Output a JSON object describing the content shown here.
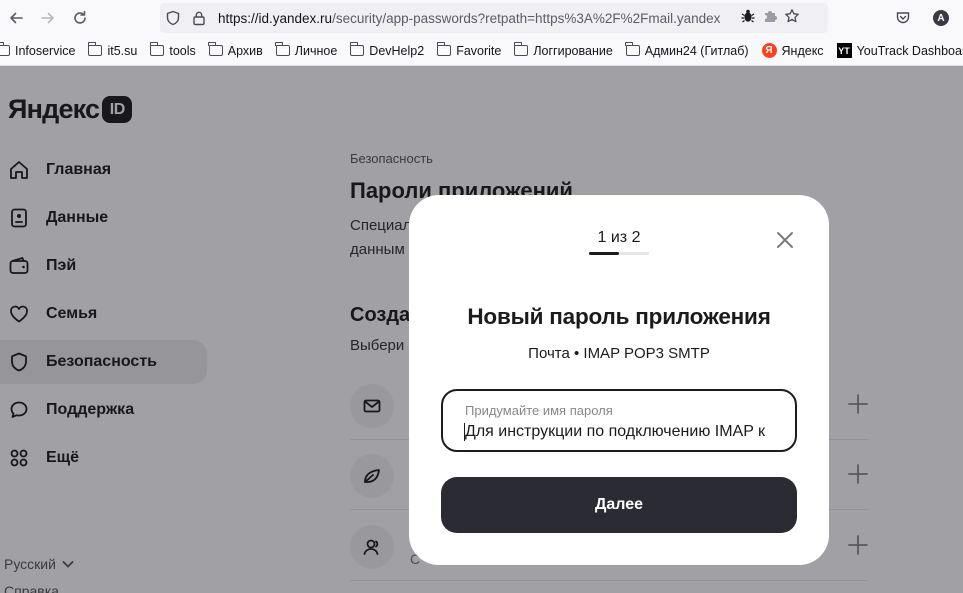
{
  "browser": {
    "url_host": "https://id.yandex.ru",
    "url_path": "/security/app-passwords?retpath=https%3A%2F%2Fmail.yandex",
    "bookmarks": [
      {
        "label": "Infoservice",
        "icon": "folder-icon"
      },
      {
        "label": "it5.su",
        "icon": "folder-icon"
      },
      {
        "label": "tools",
        "icon": "folder-icon"
      },
      {
        "label": "Архив",
        "icon": "folder-icon"
      },
      {
        "label": "Личное",
        "icon": "folder-icon"
      },
      {
        "label": "DevHelp2",
        "icon": "folder-icon"
      },
      {
        "label": "Favorite",
        "icon": "folder-icon"
      },
      {
        "label": "Логгирование",
        "icon": "folder-icon"
      },
      {
        "label": "Админ24 (Гитлаб)",
        "icon": "folder-icon"
      },
      {
        "label": "Яндекс",
        "icon": "yandex-favicon"
      },
      {
        "label": "YouTrack Dashboard",
        "icon": "youtrack-favicon"
      }
    ],
    "profile_initial": "A"
  },
  "sidebar": {
    "logo_text": "Яндекс",
    "logo_badge": "ID",
    "items": [
      {
        "label": "Главная",
        "icon": "home-icon"
      },
      {
        "label": "Данные",
        "icon": "id-card-icon"
      },
      {
        "label": "Пэй",
        "icon": "wallet-icon"
      },
      {
        "label": "Семья",
        "icon": "heart-icon"
      },
      {
        "label": "Безопасность",
        "icon": "shield-icon",
        "active": true
      },
      {
        "label": "Поддержка",
        "icon": "chat-icon"
      },
      {
        "label": "Ещё",
        "icon": "grid-icon"
      }
    ],
    "language": "Русский",
    "help": "Справка"
  },
  "main": {
    "breadcrumb": "Безопасность",
    "title": "Пароли приложений",
    "desc_line1": "Специал",
    "desc_line2": "данным",
    "create_title": "Созда",
    "create_desc": "Выбери",
    "rows": [
      {
        "icon": "mail-icon",
        "label": ""
      },
      {
        "icon": "leaf-icon",
        "label": ""
      },
      {
        "icon": "contacts-icon",
        "label": "С"
      }
    ]
  },
  "modal": {
    "step": "1 из 2",
    "progress": 0.5,
    "title": "Новый пароль приложения",
    "subtitle": "Почта • IMAP POP3 SMTP",
    "field_label": "Придумайте имя пароля",
    "field_value": "Для инструкции по подключению IMAP к",
    "next_button": "Далее"
  },
  "colors": {
    "accent_dark": "#2b2b33",
    "yandex_red": "#fc3f1d"
  }
}
